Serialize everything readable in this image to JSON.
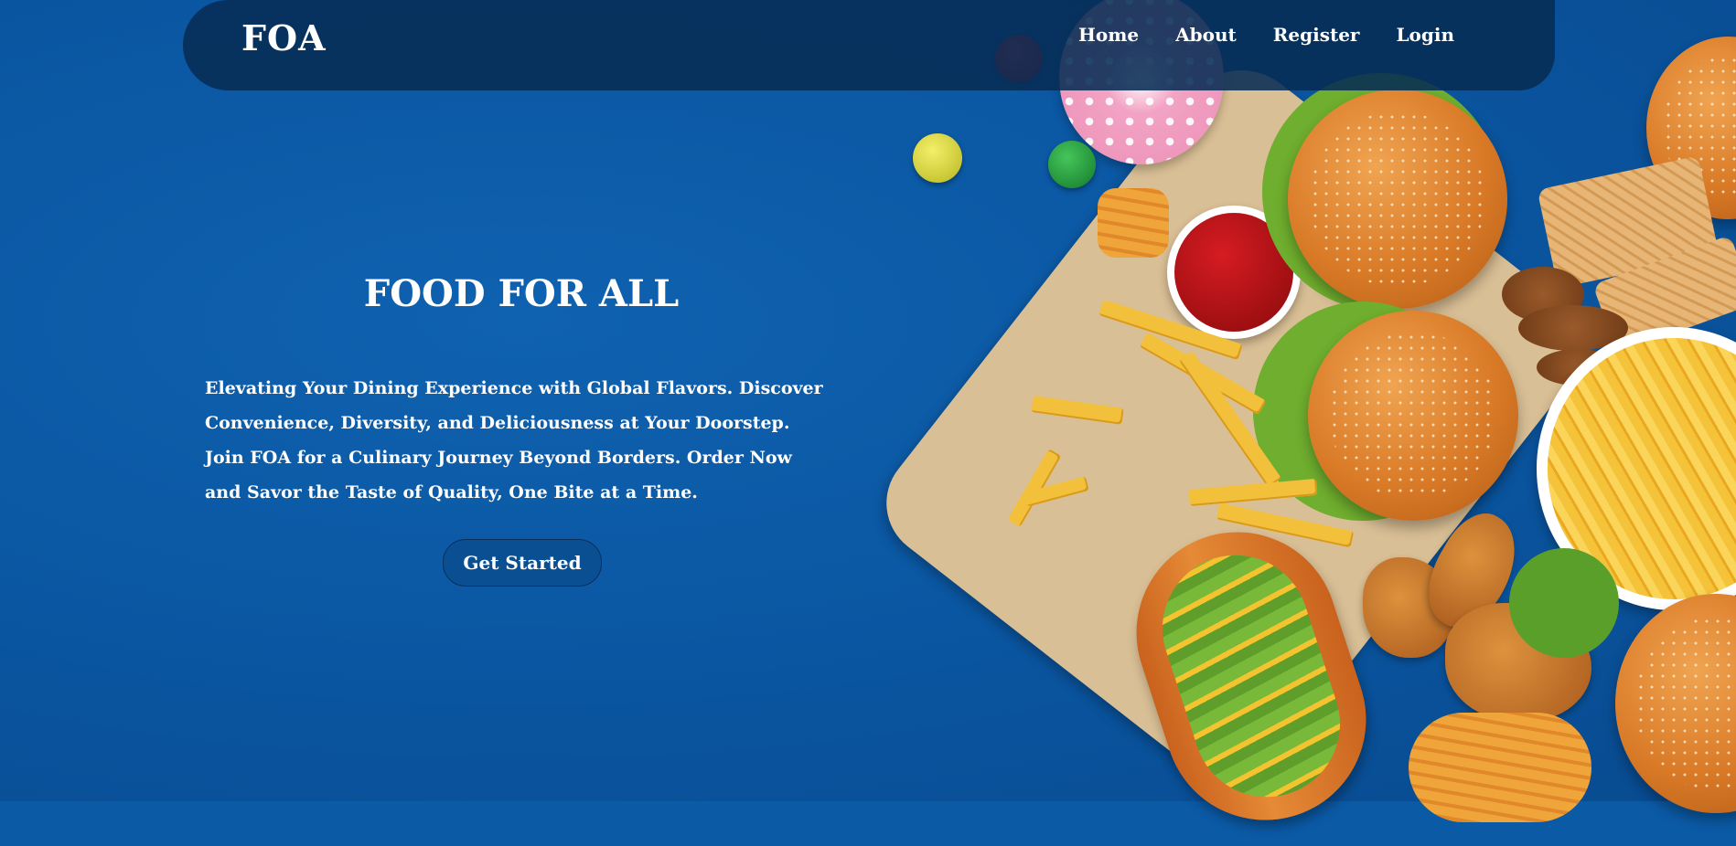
{
  "navbar": {
    "logo": "FOA",
    "links": [
      {
        "label": "Home"
      },
      {
        "label": "About"
      },
      {
        "label": "Register"
      },
      {
        "label": "Login"
      }
    ]
  },
  "hero": {
    "title": "FOOD FOR ALL",
    "lines": [
      "Elevating Your Dining Experience with Global Flavors. Discover",
      "Convenience, Diversity, and Deliciousness at Your Doorstep.",
      "Join FOA for a Culinary Journey Beyond Borders. Order Now",
      "and Savor the Taste of Quality, One Bite at a Time."
    ],
    "cta_label": "Get Started"
  },
  "colors": {
    "background": "#0b5aa6",
    "navbar": "#072c54",
    "text": "#ffffff"
  }
}
